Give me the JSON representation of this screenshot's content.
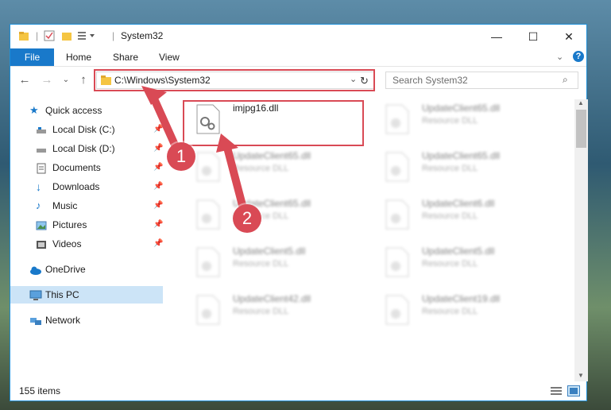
{
  "window": {
    "title": "System32",
    "controls": {
      "minimize": "—",
      "maximize": "☐",
      "close": "✕"
    }
  },
  "ribbon": {
    "file_tab": "File",
    "tabs": [
      "Home",
      "Share",
      "View"
    ]
  },
  "navigation": {
    "address_path": "C:\\Windows\\System32",
    "search_placeholder": "Search System32"
  },
  "sidebar": {
    "items": [
      {
        "label": "Quick access",
        "icon": "star-icon",
        "pinned": false
      },
      {
        "label": "Local Disk (C:)",
        "icon": "drive-icon",
        "pinned": true
      },
      {
        "label": "Local Disk (D:)",
        "icon": "drive-icon",
        "pinned": true
      },
      {
        "label": "Documents",
        "icon": "documents-icon",
        "pinned": true
      },
      {
        "label": "Downloads",
        "icon": "download-icon",
        "pinned": true
      },
      {
        "label": "Music",
        "icon": "music-icon",
        "pinned": true
      },
      {
        "label": "Pictures",
        "icon": "pictures-icon",
        "pinned": true
      },
      {
        "label": "Videos",
        "icon": "videos-icon",
        "pinned": true
      },
      {
        "label": "OneDrive",
        "icon": "cloud-icon",
        "pinned": false
      },
      {
        "label": "This PC",
        "icon": "computer-icon",
        "pinned": false,
        "selected": true
      },
      {
        "label": "Network",
        "icon": "network-icon",
        "pinned": false
      }
    ]
  },
  "files": [
    {
      "name": "imjpg16.dll",
      "type": "",
      "highlighted": true
    },
    {
      "name": "UpdateClient65.dll",
      "type": "Resource DLL"
    },
    {
      "name": "UpdateClient65.dll",
      "type": "Resource DLL"
    },
    {
      "name": "UpdateClient65.dll",
      "type": "Resource DLL"
    },
    {
      "name": "UpdateClient65.dll",
      "type": "Resource DLL"
    },
    {
      "name": "UpdateClient6.dll",
      "type": "Resource DLL"
    },
    {
      "name": "UpdateClient5.dll",
      "type": "Resource DLL"
    },
    {
      "name": "UpdateClient5.dll",
      "type": "Resource DLL"
    },
    {
      "name": "UpdateClient42.dll",
      "type": "Resource DLL"
    },
    {
      "name": "UpdateClient19.dll",
      "type": "Resource DLL"
    }
  ],
  "status": {
    "item_count": "155 items"
  },
  "annotations": {
    "step1": "1",
    "step2": "2",
    "color": "#d94a55"
  },
  "colors": {
    "accent": "#1979ca",
    "highlight": "#d94a55"
  }
}
